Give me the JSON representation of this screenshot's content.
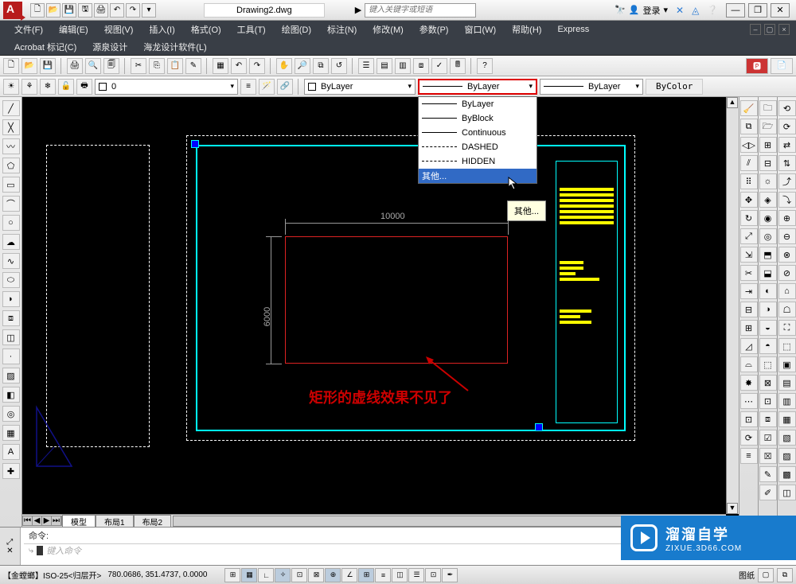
{
  "window": {
    "title": "Drawing2.dwg",
    "search_placeholder": "键入关键字或短语",
    "login": "登录"
  },
  "win_controls": {
    "min": "—",
    "max": "❐",
    "close": "✕"
  },
  "menu": {
    "row1": [
      "文件(F)",
      "编辑(E)",
      "视图(V)",
      "插入(I)",
      "格式(O)",
      "工具(T)",
      "绘图(D)",
      "标注(N)",
      "修改(M)",
      "参数(P)",
      "窗口(W)",
      "帮助(H)",
      "Express"
    ],
    "row2": [
      "Acrobat 标记(C)",
      "源泉设计",
      "海龙设计软件(L)"
    ]
  },
  "layer": {
    "current": "0"
  },
  "combos": {
    "color_label": "ByLayer",
    "linetype_label": "ByLayer",
    "lineweight_label": "ByLayer",
    "bycolor": "ByColor"
  },
  "linetype_dropdown": {
    "items": [
      "ByLayer",
      "ByBlock",
      "Continuous",
      "DASHED",
      "HIDDEN"
    ],
    "other": "其他...",
    "tooltip": "其他..."
  },
  "tabs": {
    "model": "模型",
    "layout1": "布局1",
    "layout2": "布局2"
  },
  "drawing": {
    "dim_width": "10000",
    "dim_height": "6000",
    "annotation": "矩形的虚线效果不见了"
  },
  "command": {
    "last": "命令:",
    "prompt_icon": "⤷",
    "hint": "键入命令"
  },
  "status": {
    "left_text": "【金螳螂】ISO-25<归层开>",
    "coords": "780.0686, 351.4737, 0.0000",
    "paper_label": "图纸"
  },
  "watermark": {
    "cn": "溜溜自学",
    "url": "ZIXUE.3D66.COM"
  }
}
